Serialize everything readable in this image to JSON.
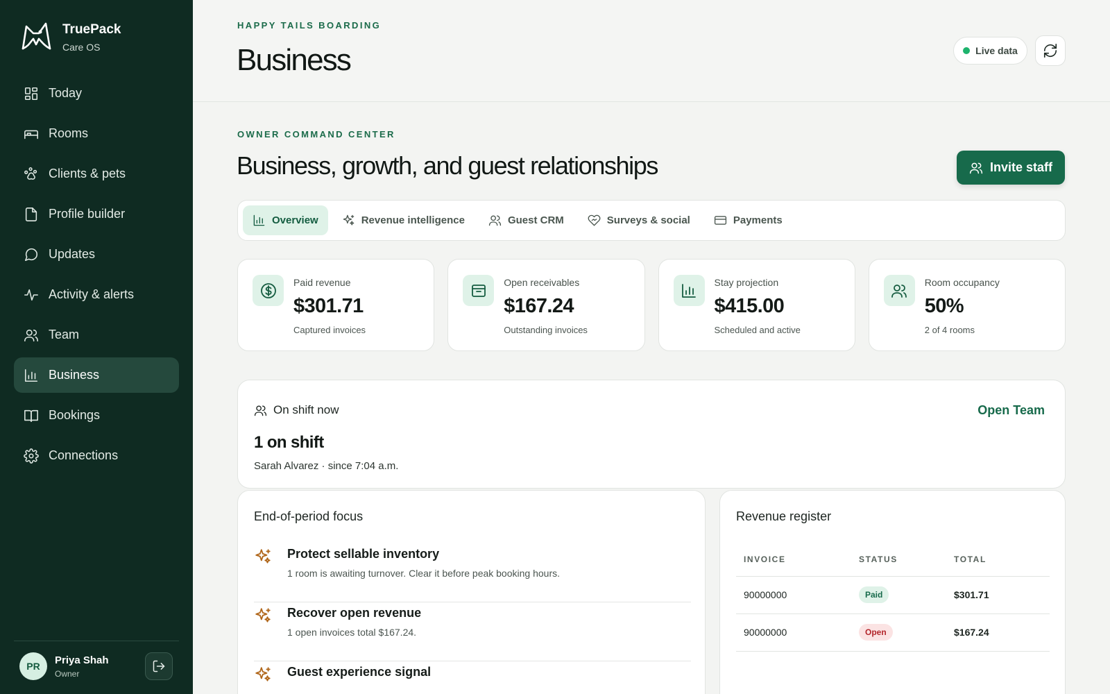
{
  "brand": {
    "name": "TruePack",
    "subtitle": "Care OS"
  },
  "sidebar": {
    "items": [
      {
        "label": "Today",
        "icon": "dashboard-icon"
      },
      {
        "label": "Rooms",
        "icon": "bed-icon"
      },
      {
        "label": "Clients & pets",
        "icon": "paw-icon"
      },
      {
        "label": "Profile builder",
        "icon": "document-icon"
      },
      {
        "label": "Updates",
        "icon": "chat-bubble-icon"
      },
      {
        "label": "Activity & alerts",
        "icon": "activity-icon"
      },
      {
        "label": "Team",
        "icon": "users-icon"
      },
      {
        "label": "Business",
        "icon": "bar-chart-icon",
        "active": true
      },
      {
        "label": "Bookings",
        "icon": "book-icon"
      },
      {
        "label": "Connections",
        "icon": "gear-icon"
      }
    ]
  },
  "user": {
    "initials": "PR",
    "name": "Priya Shah",
    "role": "Owner"
  },
  "header": {
    "eyebrow": "HAPPY TAILS BOARDING",
    "title": "Business",
    "live_label": "Live data"
  },
  "section": {
    "eyebrow": "OWNER COMMAND CENTER",
    "title": "Business, growth, and guest relationships",
    "invite_label": "Invite staff"
  },
  "tabs": [
    {
      "label": "Overview",
      "icon": "bar-chart-icon",
      "active": true
    },
    {
      "label": "Revenue intelligence",
      "icon": "sparkle-icon"
    },
    {
      "label": "Guest CRM",
      "icon": "users-icon"
    },
    {
      "label": "Surveys & social",
      "icon": "heart-icon"
    },
    {
      "label": "Payments",
      "icon": "credit-card-icon"
    }
  ],
  "stats": [
    {
      "label": "Paid revenue",
      "value": "$301.71",
      "sub": "Captured invoices",
      "icon": "dollar-icon"
    },
    {
      "label": "Open receivables",
      "value": "$167.24",
      "sub": "Outstanding invoices",
      "icon": "archive-icon"
    },
    {
      "label": "Stay projection",
      "value": "$415.00",
      "sub": "Scheduled and active",
      "icon": "bar-chart-icon"
    },
    {
      "label": "Room occupancy",
      "value": "50%",
      "sub": "2 of 4 rooms",
      "icon": "users-icon"
    }
  ],
  "shift": {
    "heading": "On shift now",
    "link": "Open Team",
    "count": "1 on shift",
    "detail": "Sarah Alvarez · since 7:04 a.m."
  },
  "focus": {
    "title": "End-of-period focus",
    "items": [
      {
        "title": "Protect sellable inventory",
        "desc": "1 room is awaiting turnover. Clear it before peak booking hours."
      },
      {
        "title": "Recover open revenue",
        "desc": "1 open invoices total $167.24."
      },
      {
        "title": "Guest experience signal",
        "desc": ""
      }
    ]
  },
  "revenue": {
    "title": "Revenue register",
    "columns": [
      "INVOICE",
      "STATUS",
      "TOTAL"
    ],
    "rows": [
      {
        "invoice": "90000000",
        "status": "Paid",
        "total": "$301.71"
      },
      {
        "invoice": "90000000",
        "status": "Open",
        "total": "$167.24"
      }
    ]
  },
  "colors": {
    "sidebar": "#0f2b22",
    "accent": "#176a4b",
    "accent_soft": "#dff2e8",
    "warning_icon": "#b0661a",
    "open_badge": "#b3262b"
  }
}
